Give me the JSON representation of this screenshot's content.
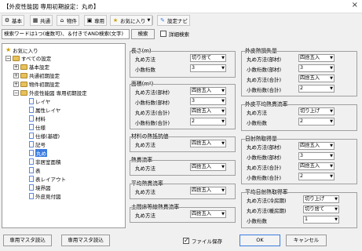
{
  "window": {
    "title": "【外皮性能図 専用初期設定：丸め】",
    "close": "×"
  },
  "toolbar": {
    "basic": "基本",
    "common": "共通",
    "property": "物件",
    "dedicated": "専用",
    "favorites": "お気に入り",
    "settings_navi": "設定ナビ"
  },
  "search": {
    "placeholder": "検索ワードは1つ(複数可)、＆付きでAND検索(文字)",
    "button": "検索",
    "detail_display": "詳細検索"
  },
  "tree": {
    "items": [
      {
        "label": "お気に入り"
      },
      {
        "label": "すべての設定"
      },
      {
        "label": "基本設定"
      },
      {
        "label": "共通初期設定"
      },
      {
        "label": "物件初期設定"
      },
      {
        "label": "外皮性能図 専用初期設定"
      },
      {
        "label": "レイヤ"
      },
      {
        "label": "属性レイヤ"
      },
      {
        "label": "材料"
      },
      {
        "label": "仕様"
      },
      {
        "label": "仕様(基礎)"
      },
      {
        "label": "記号"
      },
      {
        "label": "丸め"
      },
      {
        "label": "非居室面積"
      },
      {
        "label": "表"
      },
      {
        "label": "表レイアウト"
      },
      {
        "label": "境界図"
      },
      {
        "label": "外皮見付図"
      }
    ]
  },
  "groups": {
    "length": {
      "title": "長さ(m)",
      "rows": [
        {
          "label": "丸め方法",
          "value": "切り捨て"
        },
        {
          "label": "小数桁数",
          "value": "3"
        }
      ]
    },
    "area": {
      "title": "面積(m²)",
      "rows": [
        {
          "label": "丸め方法(部材)",
          "value": "四捨五入"
        },
        {
          "label": "小数桁数(部材)",
          "value": "3"
        },
        {
          "label": "丸め方法(合計)",
          "value": "四捨五入"
        },
        {
          "label": "小数桁数(合計)",
          "value": "2"
        }
      ]
    },
    "thermal_resistance": {
      "title": "材料の熱抵抗値",
      "rows": [
        {
          "label": "丸め方法",
          "value": "四捨五入"
        }
      ]
    },
    "heat_transmission": {
      "title": "熱貫流率",
      "rows": [
        {
          "label": "丸め方法",
          "value": "四捨五入"
        }
      ]
    },
    "avg_heat_transmission": {
      "title": "平均熱貫流率",
      "rows": [
        {
          "label": "丸め方法",
          "value": "四捨五入"
        }
      ]
    },
    "soil_floor": {
      "title": "土間床等線熱貫流率",
      "rows": [
        {
          "label": "丸め方法",
          "value": "四捨五入"
        }
      ]
    },
    "heat_loss": {
      "title": "外皮熱損失量",
      "rows": [
        {
          "label": "丸め方法(部材)",
          "value": "四捨五入"
        },
        {
          "label": "小数桁数(部材)",
          "value": "3"
        },
        {
          "label": "丸め方法(合計)",
          "value": "四捨五入"
        },
        {
          "label": "小数桁数(合計)",
          "value": "2"
        }
      ]
    },
    "outer_avg": {
      "title": "外皮平均熱貫流率",
      "rows": [
        {
          "label": "丸め方法",
          "value": "切り上げ"
        },
        {
          "label": "小数桁数",
          "value": "2"
        }
      ]
    },
    "solar_gain": {
      "title": "日射熱取得量",
      "rows": [
        {
          "label": "丸め方法(部材)",
          "value": "四捨五入"
        },
        {
          "label": "小数桁数(部材)",
          "value": "3"
        },
        {
          "label": "丸め方法(合計)",
          "value": "四捨五入"
        },
        {
          "label": "小数桁数(合計)",
          "value": "2"
        }
      ]
    },
    "avg_solar_rate": {
      "title": "平均日射熱取得率",
      "rows": [
        {
          "label": "丸め方法(冷房期)",
          "value": "切り上げ"
        },
        {
          "label": "丸め方法(暖房期)",
          "value": "切り捨て"
        },
        {
          "label": "小数桁数",
          "value": "1"
        }
      ]
    }
  },
  "footer": {
    "read_dedicated_master": "専用マスタ読込",
    "write_dedicated_master": "専用マスタ読込",
    "file_save": "ファイル保存",
    "ok": "OK",
    "cancel": "キャンセル"
  },
  "colors": {
    "selection": "#3b7ce0",
    "folder": "#e8c15a",
    "window_bg": "#f0f0f0"
  }
}
